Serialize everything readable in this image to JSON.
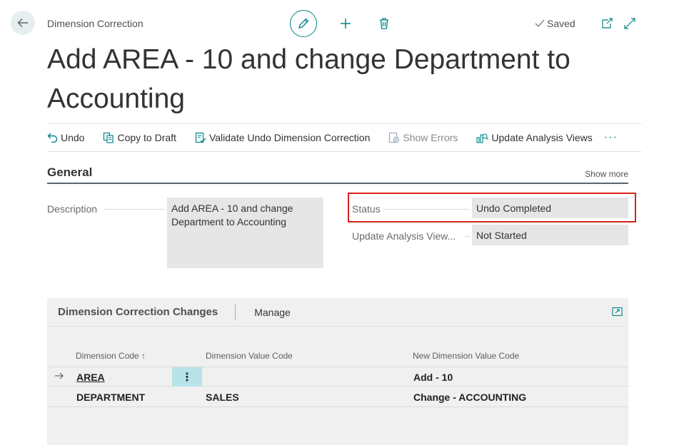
{
  "header": {
    "breadcrumb": "Dimension Correction",
    "saved_label": "Saved",
    "title": "Add AREA - 10 and change Department to Accounting"
  },
  "actions": {
    "undo": "Undo",
    "copy_to_draft": "Copy to Draft",
    "validate_undo": "Validate Undo Dimension Correction",
    "show_errors": "Show Errors",
    "update_analysis_views": "Update Analysis Views",
    "more": "···"
  },
  "general": {
    "title": "General",
    "show_more": "Show more",
    "description_label": "Description",
    "description_value": "Add AREA - 10 and change Department to Accounting",
    "status_label": "Status",
    "status_value": "Undo Completed",
    "update_label": "Update Analysis View...",
    "update_value": "Not Started"
  },
  "changes": {
    "title": "Dimension Correction Changes",
    "manage": "Manage",
    "columns": [
      "Dimension Code ↑",
      "Dimension Value Code",
      "New Dimension Value Code"
    ],
    "rows": [
      {
        "code": "AREA",
        "value": "",
        "new_value": "Add - 10"
      },
      {
        "code": "DEPARTMENT",
        "value": "SALES",
        "new_value": "Change - ACCOUNTING"
      }
    ]
  },
  "colors": {
    "accent": "#00858a",
    "highlight_border": "#d9221c",
    "row_menu_bg": "#b7e4e8"
  }
}
